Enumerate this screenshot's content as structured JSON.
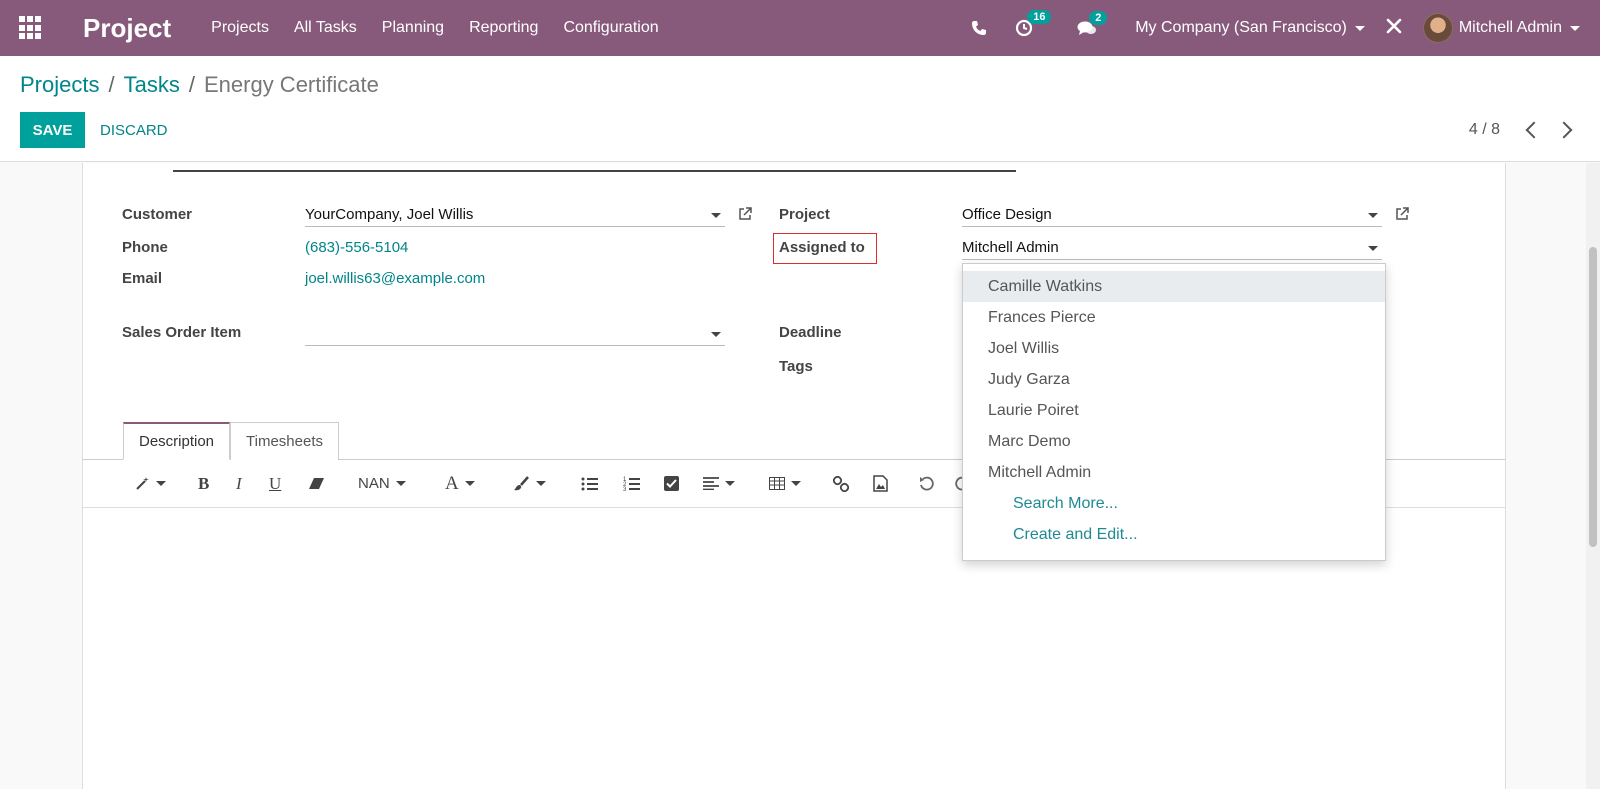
{
  "navbar": {
    "app_title": "Project",
    "menu": [
      "Projects",
      "All Tasks",
      "Planning",
      "Reporting",
      "Configuration"
    ],
    "activity_count": "16",
    "message_count": "2",
    "company": "My Company (San Francisco)",
    "user": "Mitchell Admin"
  },
  "breadcrumb": {
    "projects": "Projects",
    "tasks": "Tasks",
    "current": "Energy Certificate",
    "sep": "/"
  },
  "buttons": {
    "save": "SAVE",
    "discard": "DISCARD"
  },
  "pager": {
    "value": "4 / 8"
  },
  "form": {
    "customer_label": "Customer",
    "customer_value": "YourCompany, Joel Willis",
    "phone_label": "Phone",
    "phone_value": "(683)-556-5104",
    "email_label": "Email",
    "email_value": "joel.willis63@example.com",
    "sales_order_label": "Sales Order Item",
    "sales_order_value": "",
    "project_label": "Project",
    "project_value": "Office Design",
    "assigned_label": "Assigned to",
    "assigned_value": "Mitchell Admin",
    "deadline_label": "Deadline",
    "tags_label": "Tags"
  },
  "tabs": [
    "Description",
    "Timesheets"
  ],
  "toolbar": {
    "font_size": "NAN"
  },
  "dropdown": {
    "options": [
      "Camille Watkins",
      "Frances Pierce",
      "Joel Willis",
      "Judy Garza",
      "Laurie Poiret",
      "Marc Demo",
      "Mitchell Admin"
    ],
    "search_more": "Search More...",
    "create_edit": "Create and Edit..."
  },
  "colors": {
    "navbar": "#875a7b",
    "primary": "#00a09d",
    "link": "#00858a",
    "highlight": "#e02b2b"
  }
}
